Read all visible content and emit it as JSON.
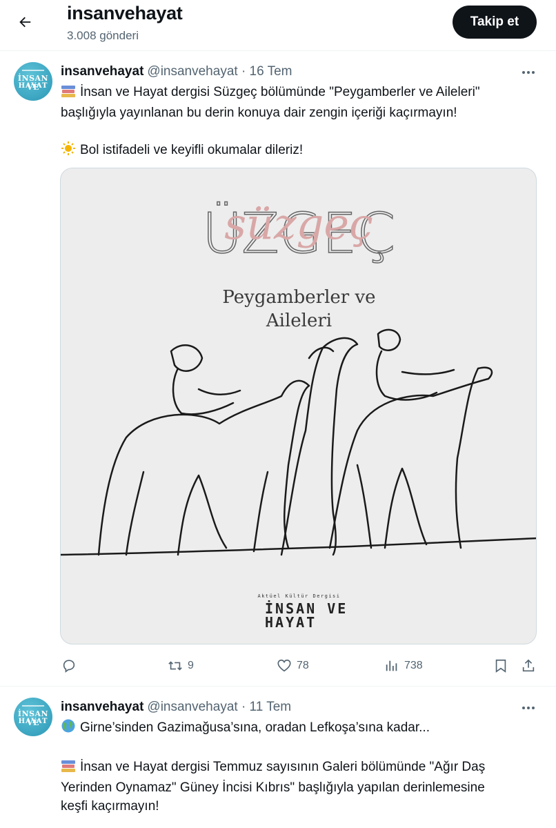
{
  "header": {
    "name": "insanvehayat",
    "post_count": "3.008 gönderi",
    "follow_label": "Takip et"
  },
  "avatar": {
    "line1": "İNSAN VE",
    "line2": "HAYAT"
  },
  "tweets": [
    {
      "name": "insanvehayat",
      "handle_date": "@insanvehayat · 16 Tem",
      "lines": [
        "İnsan ve Hayat dergisi Süzgeç bölümünde \"Peygamberler ve Aileleri\"",
        "başlığıyla yayınlanan bu derin konuya dair zengin içeriği kaçırmayın!",
        "",
        "Bol istifadeli ve keyifli okumalar dileriz!"
      ],
      "media": {
        "brand_text": "süzgeç",
        "title_line1": "Peygamberler ve",
        "title_line2": "Aileleri",
        "footer_small": "Aktüel Kültür Dergisi",
        "footer_line1": "İNSAN VE",
        "footer_line2": "HAYAT"
      },
      "stats": {
        "replies": "",
        "reposts": "9",
        "likes": "78",
        "views": "738"
      }
    },
    {
      "name": "insanvehayat",
      "handle_date": "@insanvehayat · 11 Tem",
      "lines": [
        "Girne’sinden Gazimağusa’sına, oradan Lefkoşa’sına kadar...",
        "",
        "İnsan ve Hayat dergisi Temmuz sayısının Galeri bölümünde \"Ağır Daş",
        "Yerinden Oynamaz\" Güney İncisi Kıbrıs\" başlığıyla yapılan derinlemesine",
        "keşfi kaçırmayın!"
      ]
    }
  ],
  "colors": {
    "text_primary": "#0f1419",
    "text_secondary": "#536471",
    "border": "#eff3f4",
    "brand_pink": "#d9a7a7",
    "avatar_blue": "#2b97b6"
  },
  "icons": [
    "back-arrow-icon",
    "more-icon",
    "reply-icon",
    "repost-icon",
    "like-icon",
    "views-icon",
    "bookmark-icon",
    "share-icon",
    "books-emoji",
    "sun-emoji",
    "globe-emoji"
  ]
}
